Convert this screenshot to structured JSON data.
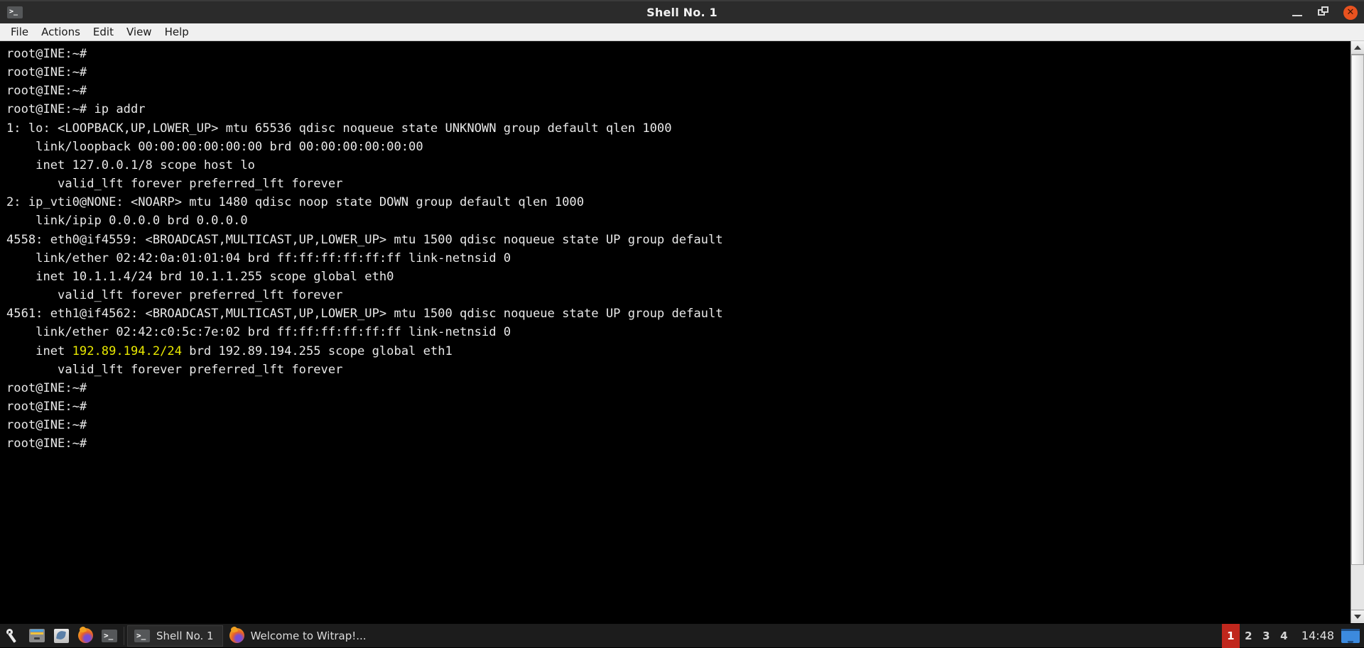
{
  "window": {
    "title": "Shell No. 1",
    "icon": "terminal-icon",
    "controls": {
      "minimize": "_",
      "maximize": "❐",
      "close": "✕"
    }
  },
  "menubar": {
    "items": [
      {
        "label": "File"
      },
      {
        "label": "Actions"
      },
      {
        "label": "Edit"
      },
      {
        "label": "View"
      },
      {
        "label": "Help"
      }
    ]
  },
  "terminal": {
    "prompt": "root@INE:~#",
    "command": "ip addr",
    "foreground_color": "#e8e8e8",
    "background_color": "#000000",
    "highlight_color": "#e8e800",
    "lines": [
      {
        "text": "root@INE:~#"
      },
      {
        "text": "root@INE:~#"
      },
      {
        "text": "root@INE:~#"
      },
      {
        "text": "root@INE:~# ip addr"
      },
      {
        "text": "1: lo: <LOOPBACK,UP,LOWER_UP> mtu 65536 qdisc noqueue state UNKNOWN group default qlen 1000"
      },
      {
        "text": "    link/loopback 00:00:00:00:00:00 brd 00:00:00:00:00:00"
      },
      {
        "text": "    inet 127.0.0.1/8 scope host lo"
      },
      {
        "text": "       valid_lft forever preferred_lft forever"
      },
      {
        "text": "2: ip_vti0@NONE: <NOARP> mtu 1480 qdisc noop state DOWN group default qlen 1000"
      },
      {
        "text": "    link/ipip 0.0.0.0 brd 0.0.0.0"
      },
      {
        "text": "4558: eth0@if4559: <BROADCAST,MULTICAST,UP,LOWER_UP> mtu 1500 qdisc noqueue state UP group default"
      },
      {
        "text": "    link/ether 02:42:0a:01:01:04 brd ff:ff:ff:ff:ff:ff link-netnsid 0"
      },
      {
        "text": "    inet 10.1.1.4/24 brd 10.1.1.255 scope global eth0"
      },
      {
        "text": "       valid_lft forever preferred_lft forever"
      },
      {
        "text": "4561: eth1@if4562: <BROADCAST,MULTICAST,UP,LOWER_UP> mtu 1500 qdisc noqueue state UP group default"
      },
      {
        "text": "    link/ether 02:42:c0:5c:7e:02 brd ff:ff:ff:ff:ff:ff link-netnsid 0"
      },
      {
        "prefix": "    inet ",
        "highlight": "192.89.194.2/24",
        "suffix": " brd 192.89.194.255 scope global eth1"
      },
      {
        "text": "       valid_lft forever preferred_lft forever"
      },
      {
        "text": "root@INE:~#"
      },
      {
        "text": "root@INE:~#"
      },
      {
        "text": "root@INE:~#"
      },
      {
        "text": "root@INE:~#"
      }
    ]
  },
  "taskbar": {
    "launchers": [
      {
        "name": "wrench-icon",
        "title": "Tools"
      },
      {
        "name": "file-manager-icon",
        "title": "File Manager"
      },
      {
        "name": "text-editor-icon",
        "title": "Text Editor"
      },
      {
        "name": "firefox-icon",
        "title": "Firefox"
      },
      {
        "name": "terminal-icon",
        "title": "Terminal"
      }
    ],
    "tasks": [
      {
        "label": "Shell No. 1",
        "icon": "terminal-icon",
        "active": true
      },
      {
        "label": "Welcome to Witrap!...",
        "icon": "firefox-icon",
        "active": false
      }
    ],
    "workspaces": [
      {
        "label": "1",
        "active": true
      },
      {
        "label": "2",
        "active": false
      },
      {
        "label": "3",
        "active": false
      },
      {
        "label": "4",
        "active": false
      }
    ],
    "clock": "14:48",
    "tray": [
      {
        "name": "display-icon"
      }
    ],
    "active_workspace_color": "#c0271d"
  }
}
